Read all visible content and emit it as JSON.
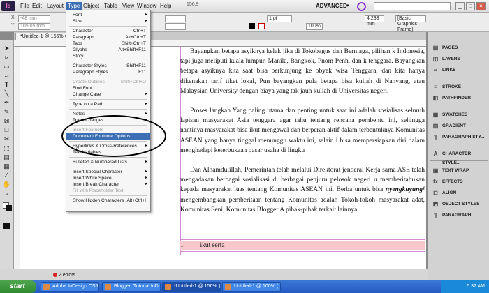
{
  "app": {
    "logo_text": "Id"
  },
  "menubar": {
    "items": [
      "File",
      "Edit",
      "Layout",
      "Type",
      "Object",
      "Table",
      "View",
      "Window",
      "Help"
    ],
    "active": "Type",
    "zoom": "156.9",
    "workspace": "ADVANCED"
  },
  "controlbar": {
    "x_field": "-48 mm",
    "y_field": "105.05 mm",
    "w_field": "",
    "size": "1 pt",
    "pct1": "100%",
    "pct2": "100%",
    "mm_value": "4.233 mm",
    "frame_style": "[Basic Graphics Frame]"
  },
  "doc_tab": "*Untitled-1 @ 156% ×",
  "type_menu": {
    "items": [
      {
        "label": "Font",
        "shortcut": "",
        "arrow": true,
        "disabled": false
      },
      {
        "label": "Size",
        "shortcut": "",
        "arrow": true,
        "disabled": false
      },
      {
        "sep": true
      },
      {
        "label": "Character",
        "shortcut": "Ctrl+T",
        "disabled": false
      },
      {
        "label": "Paragraph",
        "shortcut": "Alt+Ctrl+T",
        "disabled": false
      },
      {
        "label": "Tabs",
        "shortcut": "Shift+Ctrl+T",
        "disabled": false
      },
      {
        "label": "Glyphs",
        "shortcut": "Alt+Shift+F11",
        "disabled": false
      },
      {
        "label": "Story",
        "shortcut": "",
        "disabled": false
      },
      {
        "sep": true
      },
      {
        "label": "Character Styles",
        "shortcut": "Shift+F11",
        "disabled": false
      },
      {
        "label": "Paragraph Styles",
        "shortcut": "F11",
        "disabled": false
      },
      {
        "sep": true
      },
      {
        "label": "Create Outlines",
        "shortcut": "Shift+Ctrl+O",
        "disabled": true
      },
      {
        "label": "Find Font...",
        "shortcut": "",
        "disabled": false
      },
      {
        "label": "Change Case",
        "shortcut": "",
        "arrow": true,
        "disabled": false
      },
      {
        "sep": true
      },
      {
        "label": "Type on a Path",
        "shortcut": "",
        "arrow": true,
        "disabled": false
      },
      {
        "sep": true
      },
      {
        "label": "Notes",
        "shortcut": "",
        "arrow": true,
        "disabled": false
      },
      {
        "label": "Track Changes",
        "shortcut": "",
        "arrow": true,
        "disabled": false
      },
      {
        "sep": true
      },
      {
        "label": "Insert Footnote",
        "shortcut": "",
        "disabled": true
      },
      {
        "label": "Document Footnote Options...",
        "shortcut": "",
        "disabled": false,
        "highlight": true
      },
      {
        "sep": true
      },
      {
        "label": "Hyperlinks & Cross-References",
        "shortcut": "",
        "arrow": true,
        "disabled": false
      },
      {
        "label": "Text Variables",
        "shortcut": "",
        "arrow": true,
        "disabled": false
      },
      {
        "sep": true
      },
      {
        "label": "Bulleted & Numbered Lists",
        "shortcut": "",
        "arrow": true,
        "disabled": false
      },
      {
        "sep": true
      },
      {
        "label": "Insert Special Character",
        "shortcut": "",
        "arrow": true,
        "disabled": false
      },
      {
        "label": "Insert White Space",
        "shortcut": "",
        "arrow": true,
        "disabled": false
      },
      {
        "label": "Insert Break Character",
        "shortcut": "",
        "arrow": true,
        "disabled": false
      },
      {
        "label": "Fill with Placeholder Text",
        "shortcut": "",
        "disabled": true
      },
      {
        "sep": true
      },
      {
        "label": "Show Hidden Characters",
        "shortcut": "Alt+Ctrl+I",
        "disabled": false
      }
    ]
  },
  "document": {
    "paragraphs": [
      {
        "before": "Bayangkan betapa asyiknya kelak jika di Tokobagus dan Berniaga, pilihan k Indonesia, tapi juga meliputi kuala lumpur, Manila, Bangkok, Pnom Penh, dan k tenggara. Bayangkan betapa asyiknya kita saat bisa berkunjung ke obyek wisa Tenggara, dan kita hanya dikenakan tarif tiket lokal, Pun bayangkan pula betapa bisa kuliah di Nanyang, atau Malaysian University dengan biaya yang tak jauh kuliah di Universitas negeri.",
        "emph": "",
        "after": ""
      },
      {
        "before": "Proses langkah Yang paling utama dan penting untuk saat ini adalah sosialisas seluruh lapisan masyarakat Asia tenggara agar tahu tentang rencana pembentu ini, sehingga nantinya masyarakat bisa ikut mengawal dan berperan aktif dalam terbentuknya Komunitas ASEAN yang hanya tinggal menunggu waktu ini, selain i bisa mempersiapkan diri dalam menghadapi keterbukaan pasar usaha di lingku",
        "emph": "",
        "after": ""
      },
      {
        "before": "Dan Alhamdulillah, Pemerintah telah melalui Direktorat jenderal Kerja sama ASE telah mengadakan berbagai sosialisasi di berbagai penjuru pelosok negeri u memberitahukan kepada masyarakat luas tentang Komunitas ASEAN ini. Berba untuk bisa ",
        "emph": "nyengkuyung¹",
        "after": " mengembangkan pemberitaan tentang Komunitas adalah Tokoh-tokoh masyarakat adat, Komunitas Seni, Komunitas Blogger A pihak-pihak terkait lainnya."
      }
    ],
    "footnote": "1          ikut serta"
  },
  "right_panel": {
    "items": [
      {
        "label": "PAGES",
        "icon": "pages-icon"
      },
      {
        "label": "LAYERS",
        "icon": "layers-icon"
      },
      {
        "label": "LINKS",
        "icon": "links-icon"
      },
      {
        "label": "STROKE",
        "icon": "stroke-icon"
      },
      {
        "label": "PATHFINDER",
        "icon": "pathfinder-icon"
      },
      {
        "label": "SWATCHES",
        "icon": "swatches-icon"
      },
      {
        "label": "GRADIENT",
        "icon": "gradient-icon"
      },
      {
        "label": "PARAGRAPH STY...",
        "icon": "paragraph-styles-icon"
      },
      {
        "label": "CHARACTER STYLE...",
        "icon": "character-styles-icon"
      },
      {
        "label": "TEXT WRAP",
        "icon": "text-wrap-icon"
      },
      {
        "label": "EFFECTS",
        "icon": "effects-icon"
      },
      {
        "label": "ALIGN",
        "icon": "align-icon"
      },
      {
        "label": "OBJECT STYLES",
        "icon": "object-styles-icon"
      },
      {
        "label": "PARAGRAPH",
        "icon": "paragraph-icon"
      }
    ]
  },
  "status": {
    "errors": "2 errors"
  },
  "taskbar": {
    "start": "start",
    "tasks": [
      {
        "label": "Adobe InDesign CS5",
        "active": false
      },
      {
        "label": "Blogger: Tutorial InD...",
        "active": false
      },
      {
        "label": "*Untitled-1 @ 156% @...",
        "active": true
      },
      {
        "label": "Untitled-1 @ 100% (...",
        "active": false
      }
    ],
    "clock": "5:32 AM"
  },
  "colors": {
    "menu_highlight": "#3d6fb5",
    "guide": "#d38ad3",
    "footnote_bg": "#f6c8cc"
  }
}
